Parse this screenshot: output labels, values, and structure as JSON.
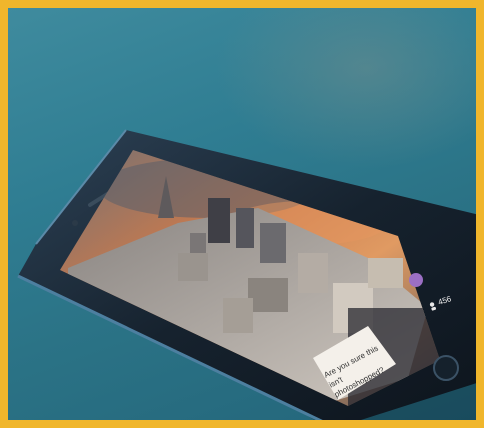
{
  "image": {
    "description_tag": "photo-of-phone-on-desk"
  },
  "phone_screen": {
    "comment_text": "Are you sure this isn't photoshopped?",
    "viewer_count": "456"
  },
  "colors": {
    "frame_border": "#f0b62c",
    "desk": "#2f7d92",
    "phone_body": "#1f2f3f",
    "chat_bubble": "#f4f0ea",
    "accent_purple": "#9b6fc4"
  }
}
